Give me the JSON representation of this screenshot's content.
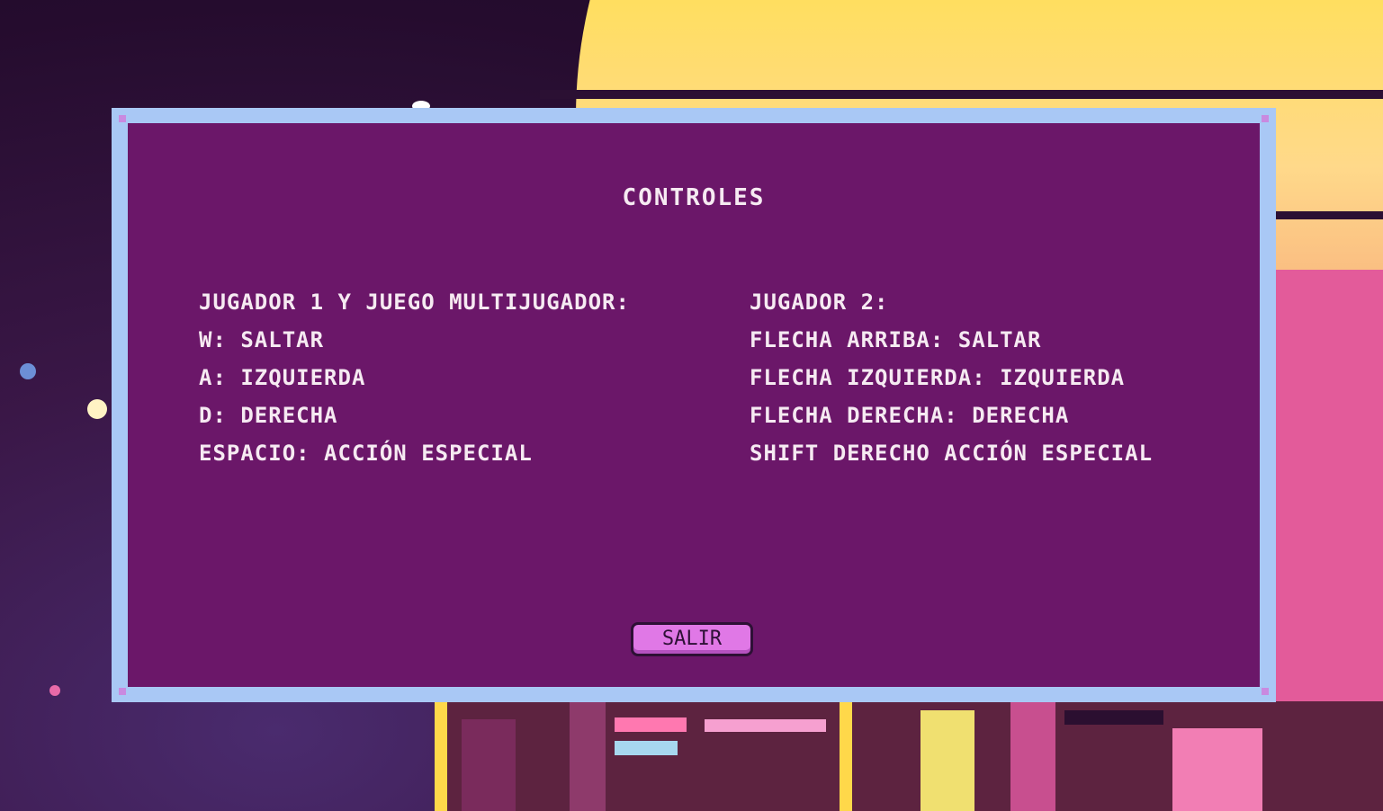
{
  "dialog": {
    "title": "CONTROLES",
    "player1": {
      "heading": "JUGADOR 1 Y JUEGO MULTIJUGADOR:",
      "controls": [
        "W: SALTAR",
        "A: IZQUIERDA",
        "D: DERECHA",
        "ESPACIO: ACCIÓN ESPECIAL"
      ]
    },
    "player2": {
      "heading": "JUGADOR 2:",
      "controls": [
        "FLECHA ARRIBA: SALTAR",
        "FLECHA IZQUIERDA: IZQUIERDA",
        "FLECHA DERECHA: DERECHA",
        "SHIFT DERECHO ACCIÓN ESPECIAL"
      ]
    },
    "exit_label": "SALIR"
  },
  "colors": {
    "panel": "#6b1769",
    "border": "#a9c8f5",
    "button": "#e078e6",
    "text": "#f6eaf2"
  }
}
